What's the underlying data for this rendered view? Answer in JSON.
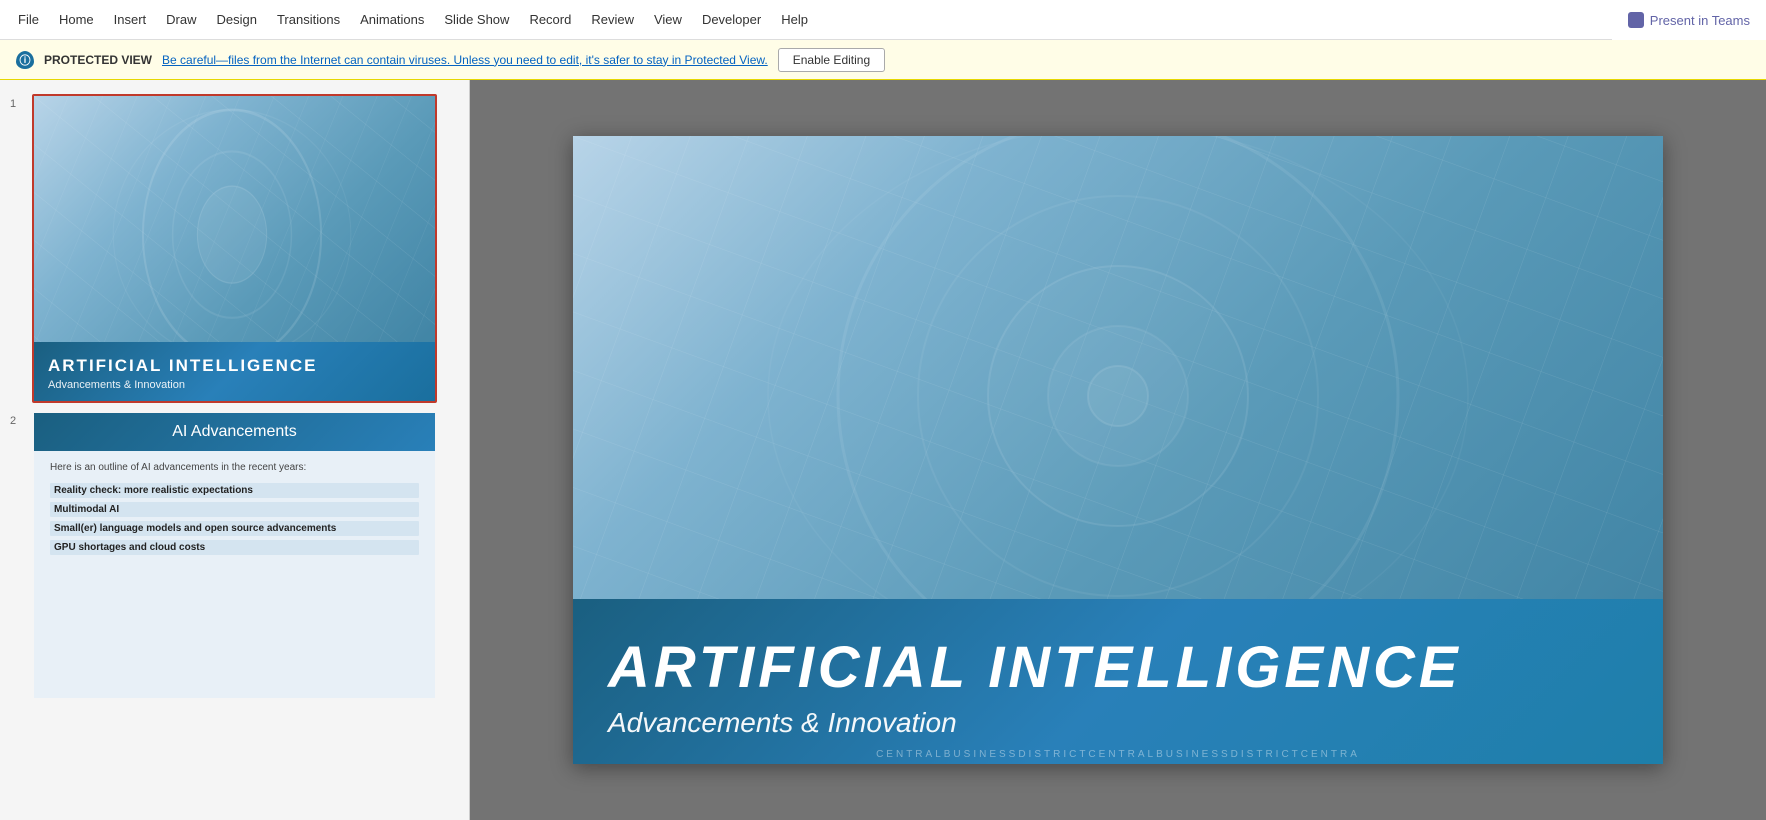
{
  "menubar": {
    "items": [
      {
        "label": "File",
        "name": "file"
      },
      {
        "label": "Home",
        "name": "home"
      },
      {
        "label": "Insert",
        "name": "insert"
      },
      {
        "label": "Draw",
        "name": "draw"
      },
      {
        "label": "Design",
        "name": "design"
      },
      {
        "label": "Transitions",
        "name": "transitions"
      },
      {
        "label": "Animations",
        "name": "animations"
      },
      {
        "label": "Slide Show",
        "name": "slide-show"
      },
      {
        "label": "Record",
        "name": "record"
      },
      {
        "label": "Review",
        "name": "review"
      },
      {
        "label": "View",
        "name": "view"
      },
      {
        "label": "Developer",
        "name": "developer"
      },
      {
        "label": "Help",
        "name": "help"
      }
    ],
    "present_in_teams": "Present in Teams"
  },
  "protected_view": {
    "label": "PROTECTED VIEW",
    "message": "Be careful—files from the Internet can contain viruses. Unless you need to edit, it's safer to stay in Protected View.",
    "button_label": "Enable Editing"
  },
  "slide1": {
    "number": "1",
    "title": "ARTIFICIAL INTELLIGENCE",
    "subtitle": "Advancements & Innovation"
  },
  "slide2": {
    "number": "2",
    "header": "AI Advancements",
    "intro": "Here is an outline of AI advancements in the recent years:",
    "bullets": [
      "Reality check: more realistic expectations",
      "Multimodal AI",
      "Small(er) language models and open source advancements",
      "GPU shortages and cloud costs"
    ]
  },
  "main_slide": {
    "title": "ARTIFICIAL INTELLIGENCE",
    "subtitle": "Advancements & Innovation",
    "footer": "CENTRALBUSINESSDISTRICTCENTRALBUSINESSDISTRICTCENTRA"
  }
}
